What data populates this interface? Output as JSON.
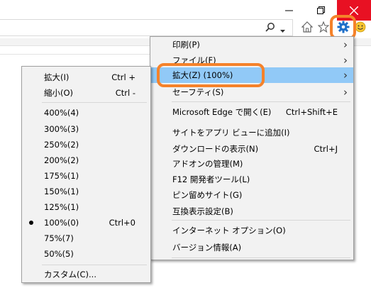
{
  "window": {
    "close_glyph": "✕",
    "close_color": "#e81123",
    "annotation_color": "#f5822a",
    "highlight_color": "#91c9f7"
  },
  "toolbar": {
    "icons": [
      "search-icon",
      "chevron-down-icon",
      "home-icon",
      "star-icon",
      "gear-icon",
      "smiley-icon"
    ]
  },
  "main_menu": {
    "items": [
      {
        "label": "印刷(P)",
        "shortcut": "",
        "submenu": true
      },
      {
        "label": "ファイル(F)",
        "shortcut": "",
        "submenu": true
      },
      {
        "label": "拡大(Z) (100%)",
        "shortcut": "",
        "submenu": true,
        "highlighted": true
      },
      {
        "label": "セーフティ(S)",
        "shortcut": "",
        "submenu": true
      },
      {
        "label": "Microsoft Edge で開く(E)",
        "shortcut": "Ctrl+Shift+E"
      },
      {
        "label": "サイトをアプリ ビューに追加(I)",
        "shortcut": ""
      },
      {
        "label": "ダウンロードの表示(N)",
        "shortcut": "Ctrl+J"
      },
      {
        "label": "アドオンの管理(M)",
        "shortcut": ""
      },
      {
        "label": "F12 開発者ツール(L)",
        "shortcut": ""
      },
      {
        "label": "ピン留めサイト(G)",
        "shortcut": ""
      },
      {
        "label": "互換表示設定(B)",
        "shortcut": ""
      },
      {
        "label": "インターネット オプション(O)",
        "shortcut": ""
      },
      {
        "label": "バージョン情報(A)",
        "shortcut": ""
      }
    ]
  },
  "zoom_menu": {
    "items": [
      {
        "label": "拡大(I)",
        "shortcut": "Ctrl +"
      },
      {
        "label": "縮小(O)",
        "shortcut": "Ctrl -"
      },
      {
        "label": "400%(4)",
        "shortcut": ""
      },
      {
        "label": "300%(3)",
        "shortcut": ""
      },
      {
        "label": "250%(2)",
        "shortcut": ""
      },
      {
        "label": "200%(2)",
        "shortcut": ""
      },
      {
        "label": "175%(1)",
        "shortcut": ""
      },
      {
        "label": "150%(1)",
        "shortcut": ""
      },
      {
        "label": "125%(1)",
        "shortcut": ""
      },
      {
        "label": "100%(0)",
        "shortcut": "Ctrl+0",
        "selected": true
      },
      {
        "label": "75%(7)",
        "shortcut": ""
      },
      {
        "label": "50%(5)",
        "shortcut": ""
      },
      {
        "label": "カスタム(C)...",
        "shortcut": ""
      }
    ]
  }
}
